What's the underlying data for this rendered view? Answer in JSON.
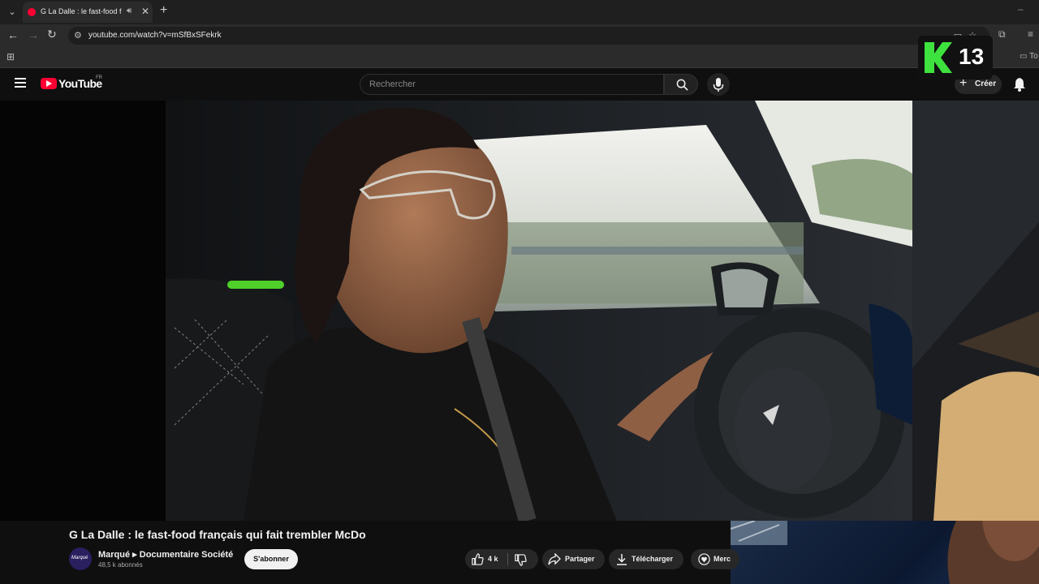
{
  "browser": {
    "tab_title": "G La Dalle : le fast-food fran",
    "url": "youtube.com/watch?v=mSfBxSFekrk",
    "bookmark_folder": "To"
  },
  "youtube": {
    "logo": "YouTube",
    "region": "FR",
    "search_placeholder": "Rechercher",
    "create_label": "Créer"
  },
  "overlay": {
    "number": "13"
  },
  "video": {
    "title": "G La Dalle : le fast-food français qui fait trembler McDo",
    "channel": {
      "avatar_text": "Marqué",
      "name": "Marqué ▸ Documentaire Société",
      "subscribers": "48,5 k abonnés"
    },
    "subscribe_label": "S'abonner",
    "like_count": "4 k",
    "share_label": "Partager",
    "download_label": "Télécharger",
    "thanks_label": "Merc"
  },
  "icons": {
    "accent": "#ff0033",
    "overlay_green": "#3ee23e"
  }
}
